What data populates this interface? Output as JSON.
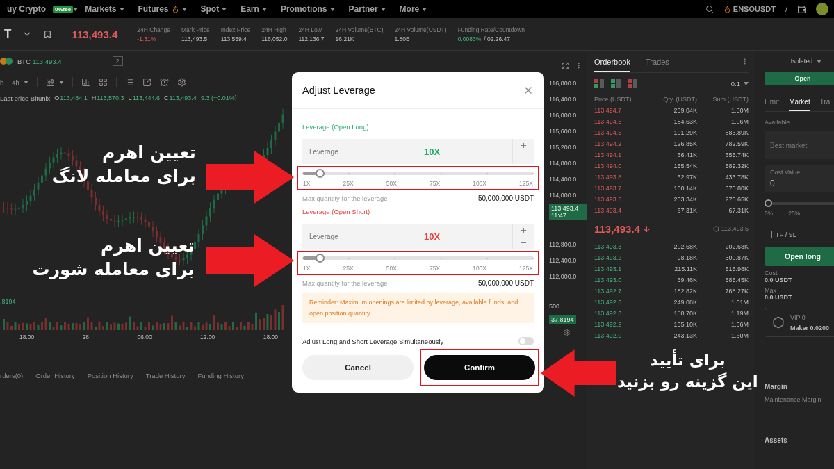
{
  "nav": {
    "brand": "uy Crypto",
    "brand_badge": "0%fee",
    "items": [
      {
        "label": "Markets",
        "kind": "plain"
      },
      {
        "label": "Futures",
        "kind": "hot"
      },
      {
        "label": "Spot",
        "kind": "plain"
      },
      {
        "label": "Earn",
        "kind": "plain"
      },
      {
        "label": "Promotions",
        "kind": "plain"
      },
      {
        "label": "Partner",
        "kind": "plain"
      },
      {
        "label": "More",
        "kind": "plain"
      }
    ],
    "hot_pair": "ENSOUSDT",
    "separator": "/"
  },
  "ticker": {
    "symbol": "T",
    "price": "113,493.4",
    "stats": [
      {
        "label": "24H Change",
        "value": "-1.31%",
        "kind": "down"
      },
      {
        "label": "Mark Price",
        "value": "113,493.5",
        "kind": "plain"
      },
      {
        "label": "Index Price",
        "value": "113,559.4",
        "kind": "plain"
      },
      {
        "label": "24H High",
        "value": "116,052.0",
        "kind": "plain"
      },
      {
        "label": "24H Low",
        "value": "112,136.7",
        "kind": "plain"
      },
      {
        "label": "24H Volume(BTC)",
        "value": "16.21K",
        "kind": "plain"
      },
      {
        "label": "24H Volume(USDT)",
        "value": "1.80B",
        "kind": "plain"
      },
      {
        "label": "Funding Rate/Countdown",
        "value": "0.0083%",
        "kind": "up",
        "extra": "/ 02:26:47"
      }
    ]
  },
  "chart": {
    "coin": "BTC",
    "coin_price": "113,493.4",
    "indicator_count": "2",
    "interval_cut": "h",
    "interval": "4h",
    "source_label": "Last price Bitunix",
    "ohlc": [
      {
        "key": "O",
        "value": "113,484.1"
      },
      {
        "key": "H",
        "value": "113,570.3"
      },
      {
        "key": "L",
        "value": "113,444.6"
      },
      {
        "key": "C",
        "value": "113,493.4"
      }
    ],
    "change": "9.3 (+0.01%)",
    "volume_value": ".8194",
    "time_labels": [
      "18:00",
      "28",
      "06:00",
      "12:00",
      "18:00"
    ],
    "price_labels": [
      "116,800.0",
      "116,400.0",
      "116,000.0",
      "115,600.0",
      "115,200.0",
      "114,800.0",
      "114,400.0",
      "114,000.0"
    ],
    "price_labels_lower": [
      "112,800.0",
      "112,400.0",
      "112,000.0"
    ],
    "last_price_tag": {
      "price": "113,493.4",
      "countdown": "11:47"
    },
    "volume_scale": "500",
    "volume_tag": "37.8194"
  },
  "bottom_tabs": [
    "rders(0)",
    "Order History",
    "Position History",
    "Trade History",
    "Funding History"
  ],
  "orderbook": {
    "tabs": [
      {
        "label": "Orderbook",
        "selected": true
      },
      {
        "label": "Trades",
        "selected": false
      }
    ],
    "precision": "0.1",
    "columns": [
      "Price (USDT)",
      "Qty. (USDT)",
      "Sum (USDT)"
    ],
    "asks": [
      [
        "113,494.7",
        "239.04K",
        "1.30M"
      ],
      [
        "113,494.6",
        "184.63K",
        "1.06M"
      ],
      [
        "113,494.5",
        "101.29K",
        "883.89K"
      ],
      [
        "113,494.2",
        "126.85K",
        "782.59K"
      ],
      [
        "113,494.1",
        "66.41K",
        "655.74K"
      ],
      [
        "113,494.0",
        "155.54K",
        "589.32K"
      ],
      [
        "113,493.8",
        "62.97K",
        "433.78K"
      ],
      [
        "113,493.7",
        "100.14K",
        "370.80K"
      ],
      [
        "113,493.5",
        "203.34K",
        "270.65K"
      ],
      [
        "113,493.4",
        "67.31K",
        "67.31K"
      ]
    ],
    "last_price": "113,493.4",
    "mark_price": "113,493.5",
    "bids": [
      [
        "113,493.3",
        "202.68K",
        "202.68K"
      ],
      [
        "113,493.2",
        "98.18K",
        "300.87K"
      ],
      [
        "113,493.1",
        "215.11K",
        "515.98K"
      ],
      [
        "113,493.0",
        "69.46K",
        "585.45K"
      ],
      [
        "113,492.7",
        "182.82K",
        "768.27K"
      ],
      [
        "113,492.5",
        "249.08K",
        "1.01M"
      ],
      [
        "113,492.3",
        "180.70K",
        "1.19M"
      ],
      [
        "113,492.2",
        "165.10K",
        "1.36M"
      ],
      [
        "113,492.0",
        "243.13K",
        "1.60M"
      ]
    ]
  },
  "order_panel": {
    "margin_mode": "Isolated",
    "open_button": "Open",
    "tabs": [
      {
        "label": "Limit",
        "selected": false
      },
      {
        "label": "Market",
        "selected": true
      },
      {
        "label": "Tra",
        "selected": false
      }
    ],
    "available_label": "Available",
    "price_placeholder": "Best market",
    "cost_label": "Cost Value",
    "cost_value": "0",
    "slider": {
      "level": 0,
      "ticks": [
        "0%",
        "25%"
      ]
    },
    "tpsl": {
      "label": "TP / SL",
      "checked": false
    },
    "submit": "Open long",
    "cost": {
      "label": "Cost",
      "value": "0.0 USDT"
    },
    "max": {
      "label": "Max",
      "value": "0.0 USDT"
    },
    "vip": {
      "level": "VIP 0",
      "fee": "Maker 0.0200"
    },
    "margin_title": "Margin",
    "maintenance_label": "Maintenance Margin",
    "assets_title": "Assets"
  },
  "dialog": {
    "title": "Adjust Leverage",
    "sections": [
      {
        "kind": "long",
        "title": "Leverage (Open Long)",
        "field_label": "Leverage",
        "value": "10X",
        "level": 0.073,
        "highlighted": true,
        "ticks": [
          "1X",
          "25X",
          "50X",
          "75X",
          "100X",
          "125X"
        ],
        "max_label": "Max quantity for the leverage",
        "max_value": "50,000,000 USDT"
      },
      {
        "kind": "short",
        "title": "Leverage (Open Short)",
        "field_label": "Leverage",
        "value": "10X",
        "level": 0.073,
        "highlighted": true,
        "ticks": [
          "1X",
          "25X",
          "50X",
          "75X",
          "100X",
          "125X"
        ],
        "max_label": "Max quantity for the leverage",
        "max_value": "50,000,000 USDT"
      }
    ],
    "reminder": "Reminder: Maximum openings are limited by leverage, available funds, and open position quantity.",
    "simultaneous": {
      "label": "Adjust Long and Short Leverage Simultaneously",
      "on": false
    },
    "buttons": [
      {
        "label": "Cancel",
        "kind": "secondary",
        "highlighted": false
      },
      {
        "label": "Confirm",
        "kind": "primary",
        "highlighted": true
      }
    ]
  },
  "annotations": [
    {
      "lines": [
        "تعیین اهرم",
        "برای معامله لانگ"
      ],
      "kind": "right"
    },
    {
      "lines": [
        "تعیین اهرم",
        "برای معامله شورت"
      ],
      "kind": "right"
    },
    {
      "lines": [
        "برای تأیید",
        "این گزینه رو بزنید"
      ],
      "kind": "left"
    }
  ]
}
